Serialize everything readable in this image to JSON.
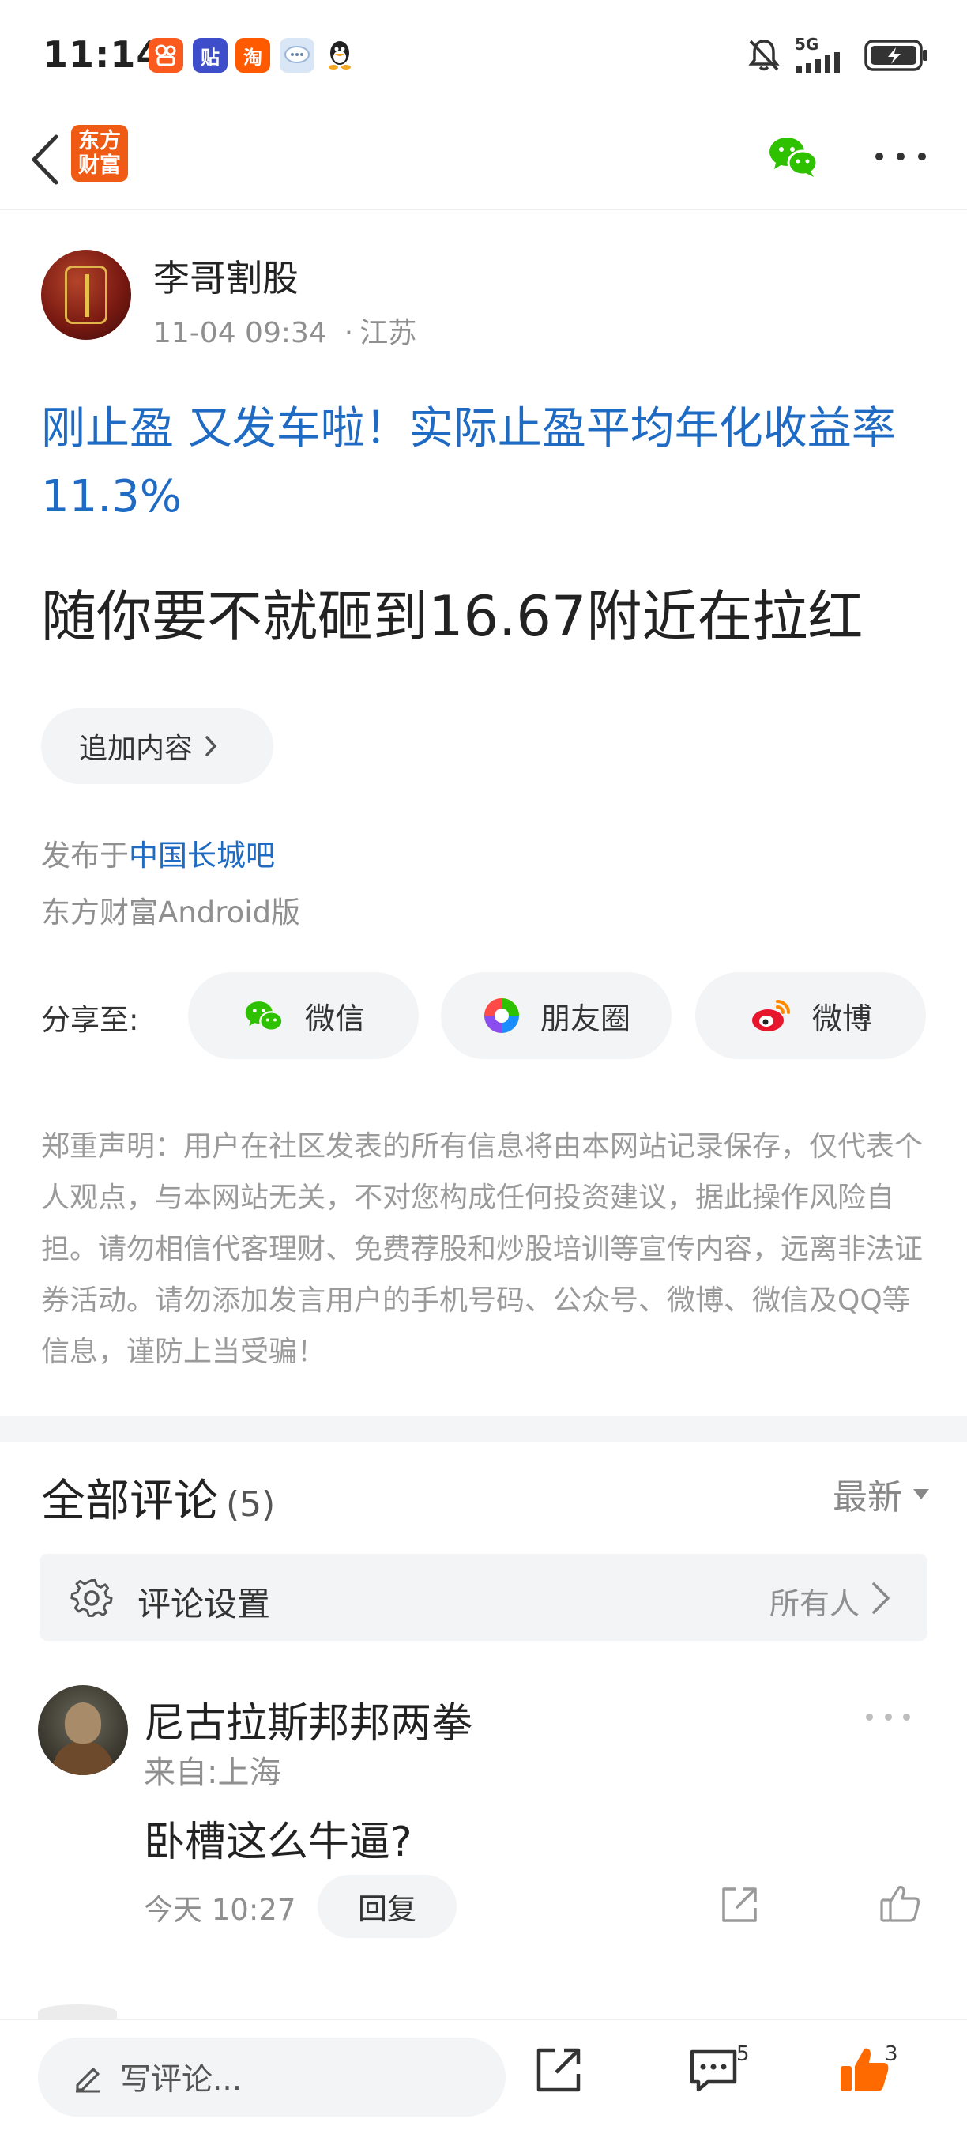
{
  "status_bar": {
    "time": "11:14",
    "apps": [
      {
        "name": "kuaishou-app-icon",
        "glyph": "⌘",
        "color": "#fa5a1e"
      },
      {
        "name": "tieba-app-icon",
        "glyph": "贴",
        "color": "#3e4dc9"
      },
      {
        "name": "taobao-app-icon",
        "glyph": "淘",
        "color": "#ff5a00"
      },
      {
        "name": "chat-bubble-app-icon",
        "glyph": "…",
        "color": "#a9c4e8"
      },
      {
        "name": "qq-app-icon",
        "glyph": "Q",
        "color": "#222222"
      }
    ],
    "network": "5G"
  },
  "nav": {
    "brand_logo_text": "东方财富"
  },
  "post": {
    "author_name": "李哥割股",
    "date": "11-04 09:34",
    "separator": "·",
    "location": "江苏",
    "title": "刚止盈 又发车啦！实际止盈平均年化收益率 11.3%",
    "body": "随你要不就砸到16.67附近在拉红",
    "append_label": "追加内容",
    "published_prefix": "发布于",
    "board_name": "中国长城吧",
    "client": "东方财富Android版",
    "share_label": "分享至:",
    "share_targets": [
      {
        "label": "微信",
        "icon": "wechat-icon"
      },
      {
        "label": "朋友圈",
        "icon": "moments-icon"
      },
      {
        "label": "微博",
        "icon": "weibo-icon"
      }
    ],
    "disclaimer": "郑重声明：用户在社区发表的所有信息将由本网站记录保存，仅代表个人观点，与本网站无关，不对您构成任何投资建议，据此操作风险自担。请勿相信代客理财、免费荐股和炒股培训等宣传内容，远离非法证券活动。请勿添加发言用户的手机号码、公众号、微博、微信及QQ等信息，谨防上当受骗！"
  },
  "comments": {
    "title": "全部评论",
    "count": "(5)",
    "sort_label": "最新",
    "settings_label": "评论设置",
    "settings_value": "所有人",
    "items": [
      {
        "name": "尼古拉斯邦邦两拳",
        "location": "来自:上海",
        "text": "卧槽这么牛逼?",
        "time": "今天 10:27",
        "reply_label": "回复"
      }
    ]
  },
  "bottom_bar": {
    "write_placeholder": "写评论...",
    "comment_count": "5",
    "like_count": "3"
  },
  "colors": {
    "brand_orange": "#ef5a14",
    "link_blue": "#1f6bc4",
    "wechat_green": "#2dc100",
    "like_orange": "#ff6a00"
  }
}
